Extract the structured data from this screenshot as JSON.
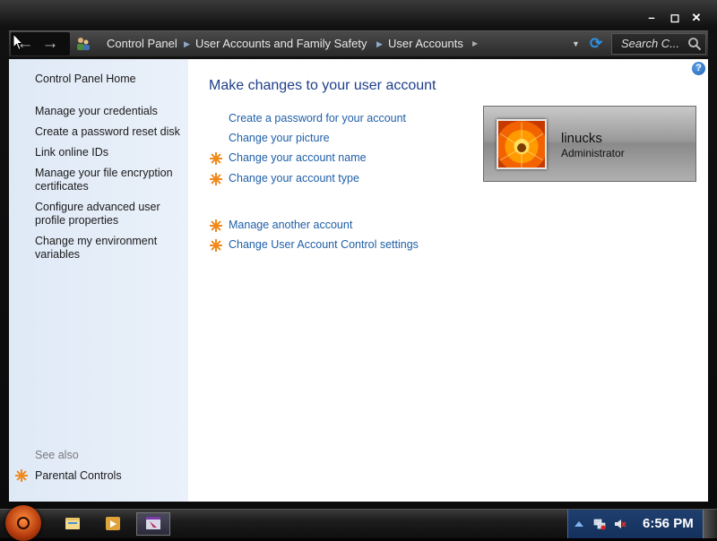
{
  "window": {
    "controls": {
      "minimize": "–",
      "maximize": "◻",
      "close": "✕"
    }
  },
  "nav": {
    "back_icon": "←",
    "forward_icon": "→",
    "breadcrumbs": [
      "Control Panel",
      "User Accounts and Family Safety",
      "User Accounts"
    ],
    "separator": "▶",
    "dropdown": "▼",
    "refresh_icon": "⟳",
    "search_placeholder": "Search C..."
  },
  "sidebar": {
    "home": "Control Panel Home",
    "links": [
      "Manage your credentials",
      "Create a password reset disk",
      "Link online IDs",
      "Manage your file encryption certificates",
      "Configure advanced user profile properties",
      "Change my environment variables"
    ],
    "see_also_label": "See also",
    "see_also_links": [
      "Parental Controls"
    ]
  },
  "main": {
    "help_icon": "?",
    "title": "Make changes to your user account",
    "tasks_group1": [
      {
        "label": "Create a password for your account",
        "shield": false
      },
      {
        "label": "Change your picture",
        "shield": false
      },
      {
        "label": "Change your account name",
        "shield": true
      },
      {
        "label": "Change your account type",
        "shield": true
      }
    ],
    "tasks_group2": [
      {
        "label": "Manage another account",
        "shield": true
      },
      {
        "label": "Change User Account Control settings",
        "shield": true
      }
    ]
  },
  "user": {
    "name": "linucks",
    "role": "Administrator"
  },
  "taskbar": {
    "clock": "6:56 PM"
  },
  "colors": {
    "link": "#1f5fa8",
    "title": "#1e3f8a",
    "sidebar_bg": "#e4edf8",
    "shield_orange": "#f08a1c"
  }
}
